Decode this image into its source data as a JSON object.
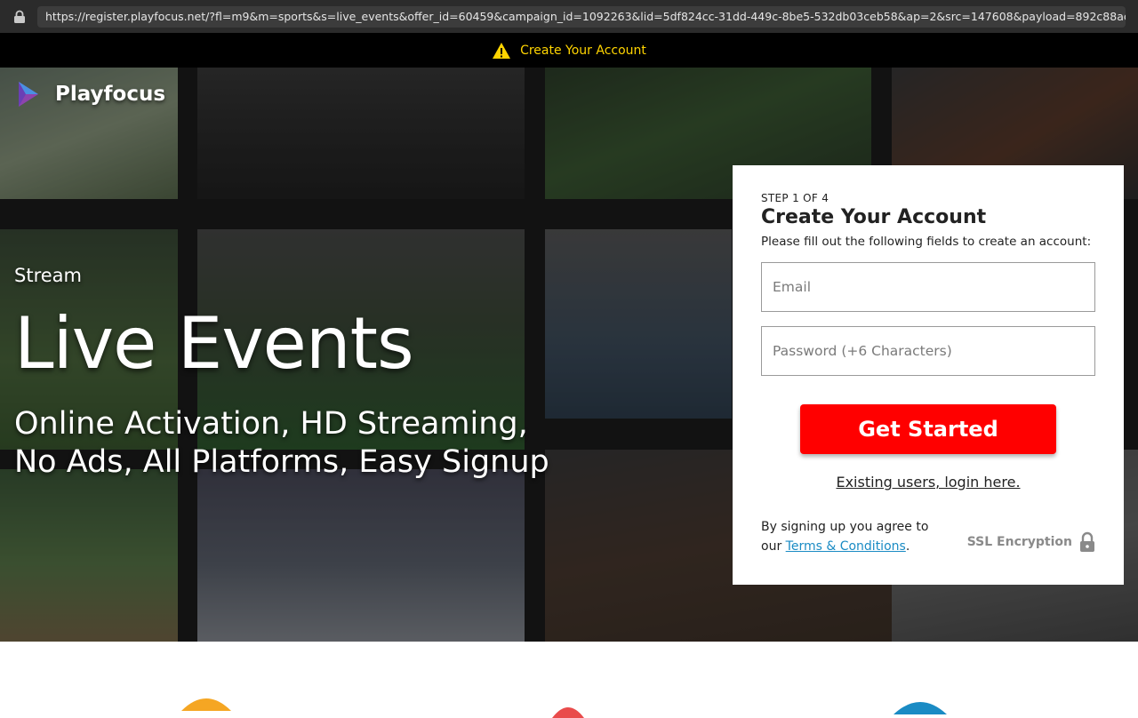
{
  "browser": {
    "url": "https://register.playfocus.net/?fl=m9&m=sports&s=live_events&offer_id=60459&campaign_id=1092263&lid=5df824cc-31dd-449c-8be5-532db03ceb58&ap=2&src=147608&payload=892c88ac9..."
  },
  "notice": {
    "text": "Create Your Account",
    "icon": "warning-icon",
    "color": "#ffd400"
  },
  "brand": {
    "name": "Playfocus",
    "icon": "play-logo-icon"
  },
  "hero": {
    "kicker": "Stream",
    "headline": "Live Events",
    "subline_1": "Online Activation, HD Streaming,",
    "subline_2": "No Ads, All Platforms, Easy Signup"
  },
  "form": {
    "step": "STEP 1 OF 4",
    "title": "Create Your Account",
    "description": "Please fill out the following fields to create an account:",
    "email_placeholder": "Email",
    "email_value": "",
    "password_placeholder": "Password (+6 Characters)",
    "password_value": "",
    "submit_label": "Get Started",
    "login_link": "Existing users, login here.",
    "legal_prefix": "By signing up you agree to",
    "legal_our": "our",
    "terms_link": "Terms & Conditions",
    "legal_suffix": ".",
    "ssl_label": "SSL Encryption",
    "ssl_icon": "lock-icon",
    "accent_color": "#ff0000",
    "link_color": "#1a8bc4"
  },
  "features": {
    "icons": [
      "badge-icon",
      "heart-icon",
      "globe-icon"
    ],
    "colors": [
      "#f5a623",
      "#e94b4b",
      "#1a8bc4"
    ]
  }
}
